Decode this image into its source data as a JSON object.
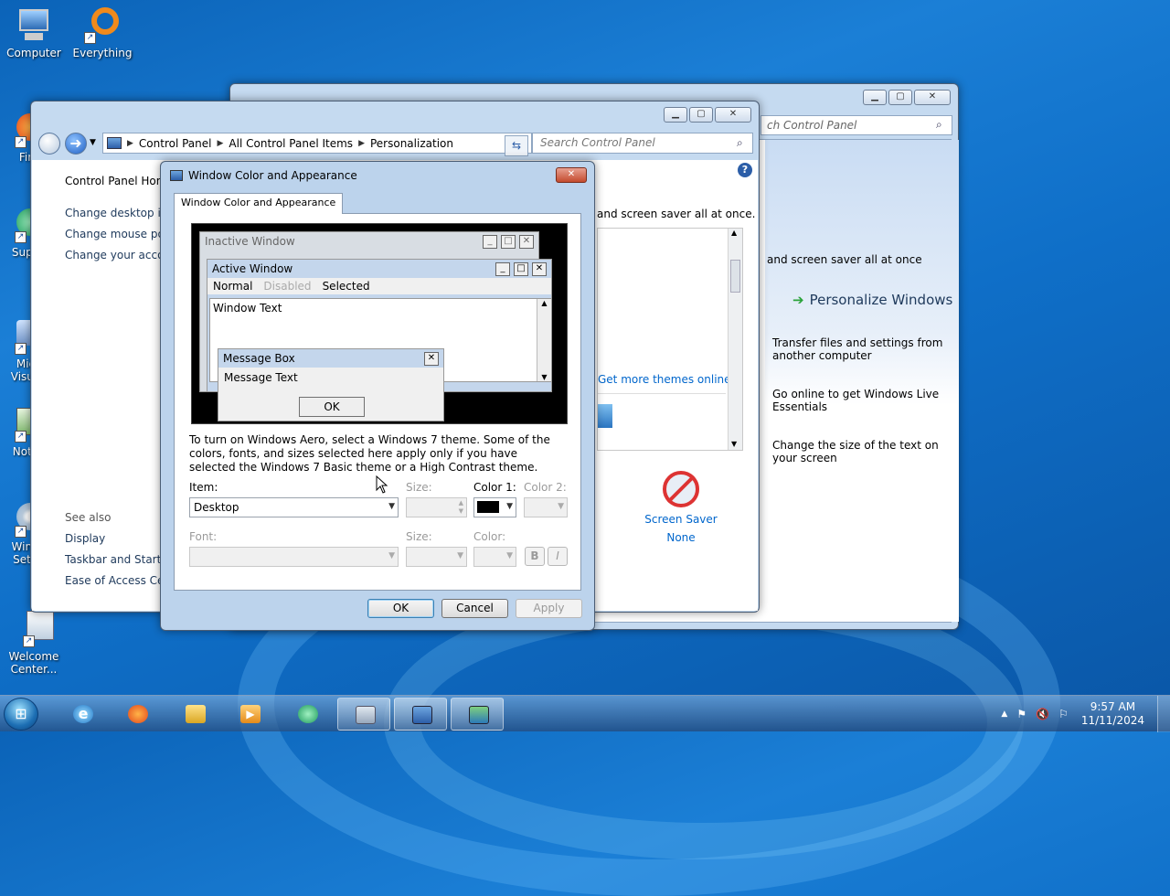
{
  "desktop": {
    "icons": [
      {
        "label": "Computer"
      },
      {
        "label": "Everything"
      },
      {
        "label": "Fir"
      },
      {
        "label": "Supe"
      },
      {
        "label": "Mic Visua"
      },
      {
        "label": "Note"
      },
      {
        "label": "WinC Setti"
      },
      {
        "label": "Welcome Center..."
      }
    ]
  },
  "back_window": {
    "search_placeholder": "ch Control Panel",
    "description": "and screen saver all at once",
    "personalize_title": "Personalize Windows",
    "tasks": [
      "Transfer files and settings from another computer",
      "Go online to get Windows Live Essentials",
      "Change the size of the text on your screen"
    ]
  },
  "control_panel": {
    "breadcrumb": [
      "Control Panel",
      "All Control Panel Items",
      "Personalization"
    ],
    "search_placeholder": "Search Control Panel",
    "left_links": [
      "Control Panel Home",
      "Change desktop ico",
      "Change mouse poin",
      "Change your accou"
    ],
    "see_also_title": "See also",
    "see_also_links": [
      "Display",
      "Taskbar and Start M",
      "Ease of Access Cente"
    ],
    "description": "and screen saver all at once.",
    "more_themes": "Get more themes online",
    "screen_saver_label": "Screen Saver",
    "screen_saver_value": "None"
  },
  "dialog": {
    "title": "Window Color and Appearance",
    "tab": "Window Color and Appearance",
    "preview": {
      "inactive_title": "Inactive Window",
      "active_title": "Active Window",
      "menu_normal": "Normal",
      "menu_disabled": "Disabled",
      "menu_selected": "Selected",
      "window_text": "Window Text",
      "msgbox_title": "Message Box",
      "msgbox_text": "Message Text",
      "msgbox_ok": "OK"
    },
    "info_text": "To turn on Windows Aero, select a Windows 7 theme.  Some of the colors, fonts, and sizes selected here apply only if you have selected the Windows 7 Basic theme or a High Contrast theme.",
    "item_label": "Item:",
    "item_value": "Desktop",
    "size_label": "Size:",
    "color1_label": "Color 1:",
    "color1_value": "#000000",
    "color2_label": "Color 2:",
    "font_label": "Font:",
    "font_size_label": "Size:",
    "font_color_label": "Color:",
    "bold": "B",
    "italic": "I",
    "ok": "OK",
    "cancel": "Cancel",
    "apply": "Apply"
  },
  "taskbar": {
    "time": "9:57 AM",
    "date": "11/11/2024"
  },
  "colors": {
    "accent": "#1e395b",
    "link": "#0066cc"
  }
}
